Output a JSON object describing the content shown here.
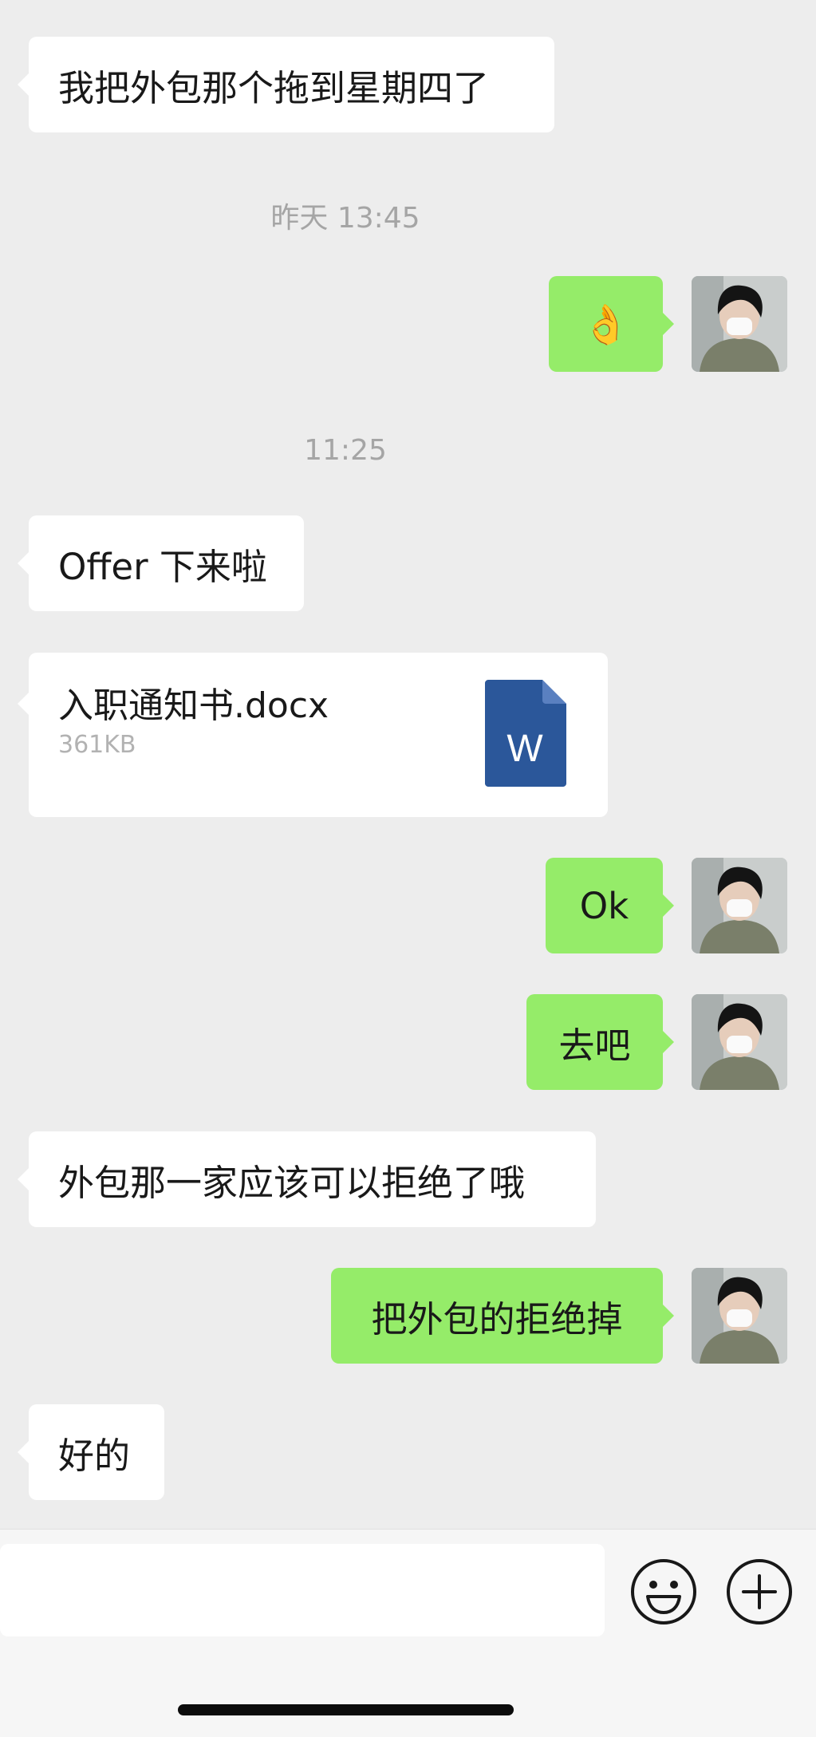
{
  "messages": [
    {
      "side": "left",
      "text": "我把外包那个拖到星期四了"
    },
    {
      "time": "昨天 13:45"
    },
    {
      "side": "right",
      "text": "👌",
      "emoji": "ok-hand"
    },
    {
      "time": "11:25"
    },
    {
      "side": "left",
      "text": "Offer 下来啦"
    },
    {
      "side": "left",
      "type": "file",
      "file_name": "入职通知书.docx",
      "file_size": "361KB",
      "file_icon": "word-doc-icon",
      "file_icon_letter": "W"
    },
    {
      "side": "right",
      "text": "Ok"
    },
    {
      "side": "right",
      "text": "去吧"
    },
    {
      "side": "left",
      "text": "外包那一家应该可以拒绝了哦"
    },
    {
      "side": "right",
      "text": "把外包的拒绝掉"
    },
    {
      "side": "left",
      "text": "好的"
    }
  ],
  "input": {
    "value": "",
    "placeholder": ""
  },
  "icons": {
    "emoji_button": "smiley-icon",
    "more_button": "plus-circle-icon"
  },
  "colors": {
    "background": "#ededed",
    "self_bubble": "#95ec69",
    "other_bubble": "#ffffff",
    "word_blue": "#2b579a"
  }
}
